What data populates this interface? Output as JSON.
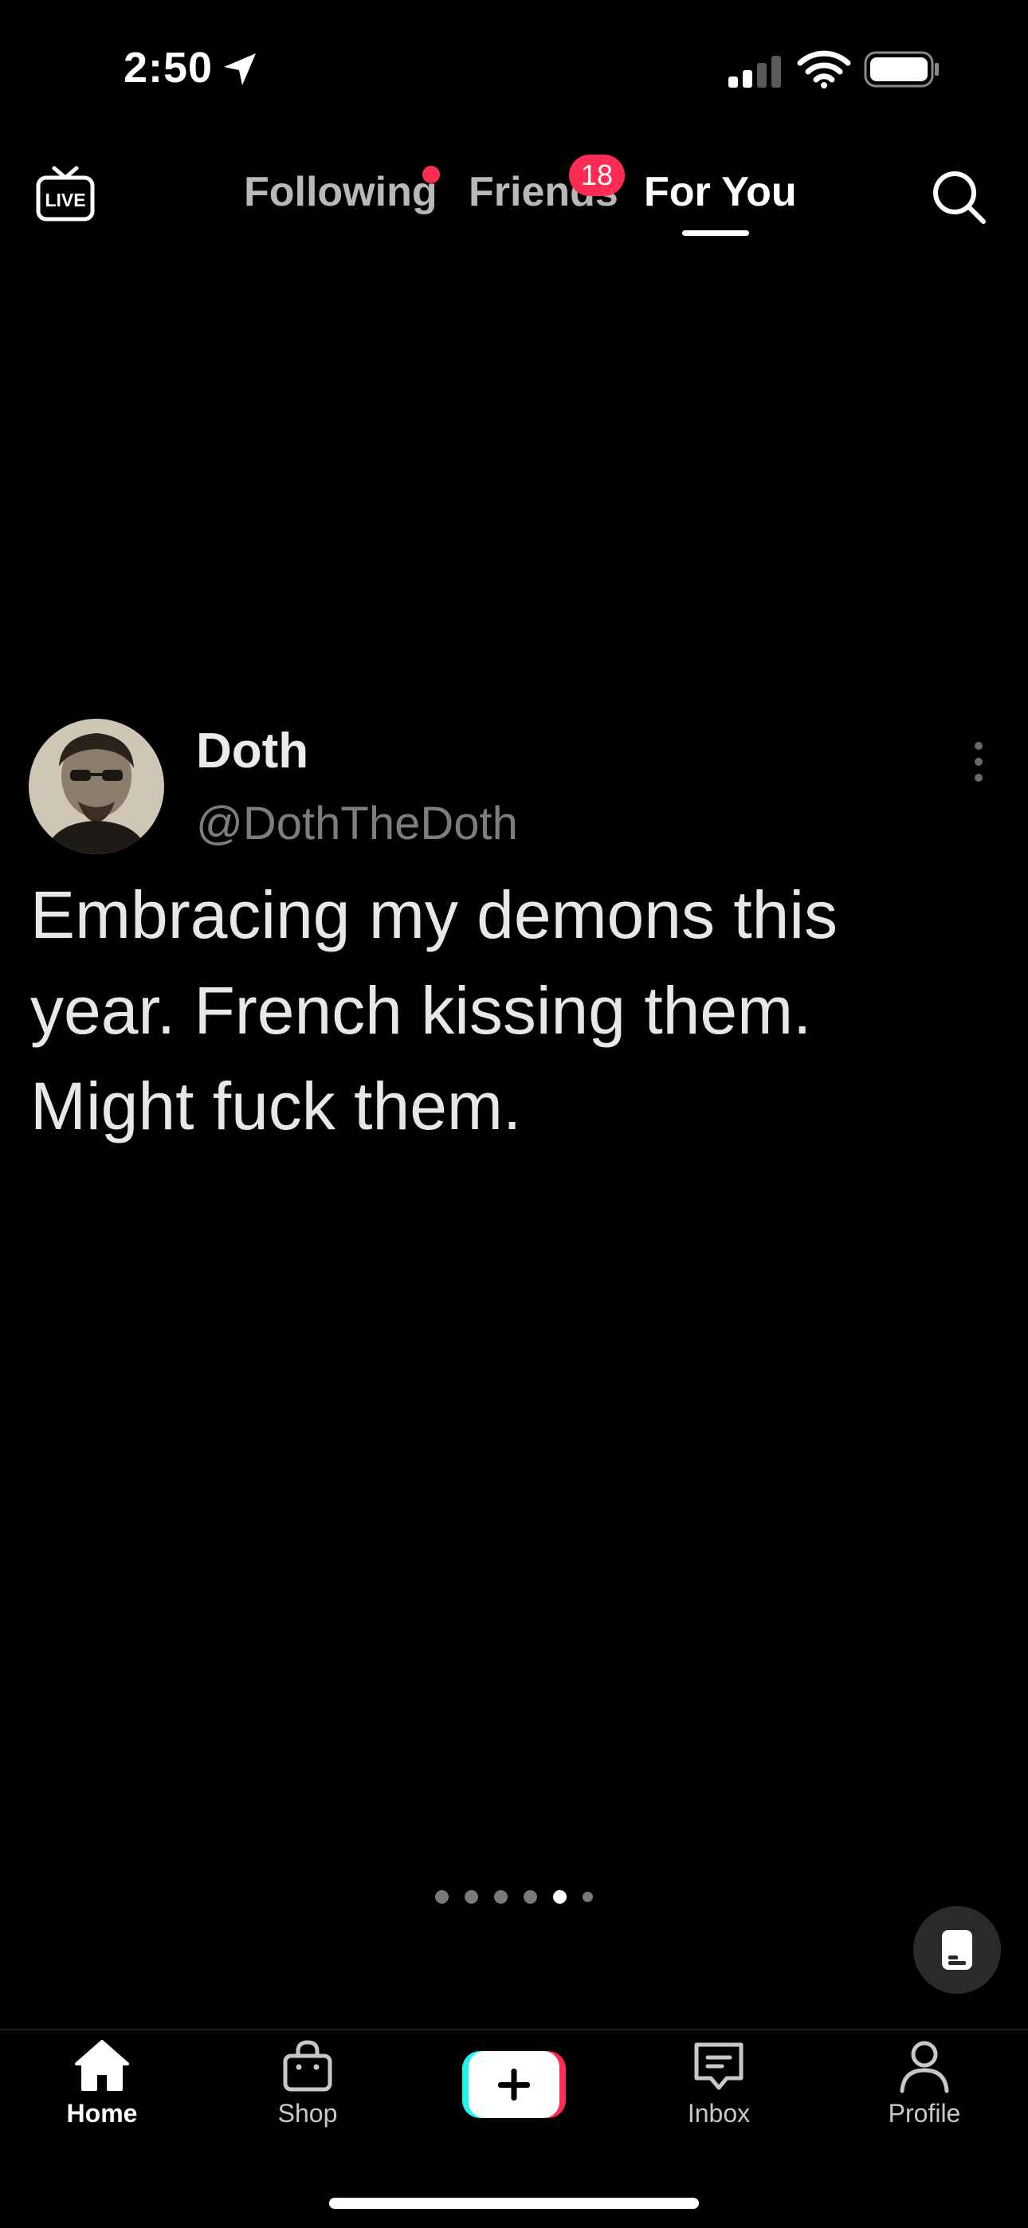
{
  "status_bar": {
    "time": "2:50",
    "icons": [
      "location-arrow-icon",
      "cellular-signal-icon",
      "wifi-icon",
      "battery-icon"
    ]
  },
  "top_nav": {
    "live_icon": "live-tv-icon",
    "live_label": "LIVE",
    "tabs": [
      {
        "label": "Following",
        "has_dot": true
      },
      {
        "label": "Friends",
        "badge": "18"
      },
      {
        "label": "For You",
        "active": true
      }
    ],
    "search_icon": "search-icon",
    "accent_color": "#fe2c55"
  },
  "post": {
    "author_name": "Doth",
    "author_handle": "@DothTheDoth",
    "text": "Embracing my demons this year. French kissing them. Might fuck them.",
    "carousel": {
      "count": 6,
      "active_index": 4
    }
  },
  "caption_button_icon": "captions-icon",
  "bottom_nav": {
    "items": [
      {
        "label": "Home",
        "icon": "home-icon",
        "active": true
      },
      {
        "label": "Shop",
        "icon": "shopping-bag-icon"
      },
      {
        "label": "",
        "icon": "create-plus-icon"
      },
      {
        "label": "Inbox",
        "icon": "inbox-message-icon"
      },
      {
        "label": "Profile",
        "icon": "profile-person-icon"
      }
    ],
    "create_colors": {
      "left": "#25f4ee",
      "right": "#fe2c55"
    }
  }
}
